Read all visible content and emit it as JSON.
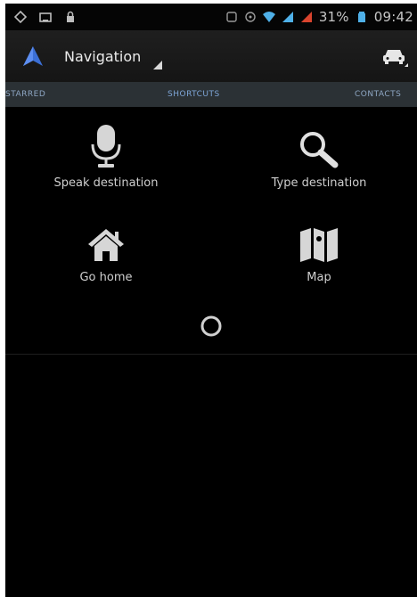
{
  "status_bar": {
    "icons": [
      "settings-icon",
      "image-icon",
      "lock-icon",
      "sync-icon",
      "alarm-icon",
      "wifi-icon",
      "signal-icon",
      "signal-icon",
      "battery-icon"
    ],
    "battery": "31%",
    "time": "09:42"
  },
  "action_bar": {
    "title": "Navigation",
    "logo_icon": "navigation-arrow-icon",
    "right_icon": "car-icon"
  },
  "tabs": [
    {
      "label": "STARRED",
      "active": false
    },
    {
      "label": "SHORTCUTS",
      "active": true
    },
    {
      "label": "CONTACTS",
      "active": false
    }
  ],
  "actions": {
    "speak": {
      "label": "Speak destination",
      "icon": "microphone-icon"
    },
    "type": {
      "label": "Type destination",
      "icon": "magnifier-icon"
    },
    "home": {
      "label": "Go home",
      "icon": "home-icon"
    },
    "map": {
      "label": "Map",
      "icon": "map-icon"
    }
  },
  "colors": {
    "background": "#000000",
    "action_bar": "#1a1a1a",
    "tab_strip": "#2b3135",
    "tab_text": "#7ea6d8",
    "accent_blue": "#3b6fd6"
  }
}
